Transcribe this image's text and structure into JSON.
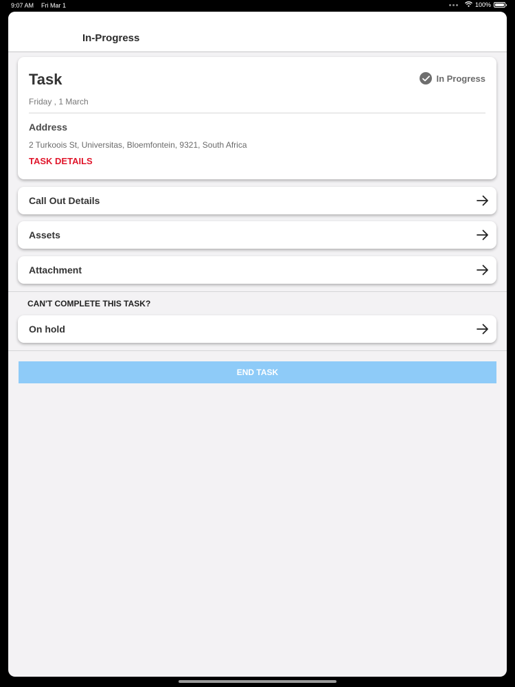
{
  "status_bar": {
    "time": "9:07 AM",
    "date": "Fri Mar 1",
    "battery": "100%",
    "icons": [
      "wifi-icon",
      "battery-icon"
    ]
  },
  "header": {
    "title": "In-Progress"
  },
  "task": {
    "title": "Task",
    "status": "In Progress",
    "date": "Friday , 1 March",
    "address_label": "Address",
    "address": "2 Turkoois St, Universitas, Bloemfontein, 9321, South Africa",
    "details_link": "TASK DETAILS"
  },
  "rows": {
    "call_out_details": "Call Out Details",
    "assets": "Assets",
    "attachment": "Attachment"
  },
  "cant_complete": {
    "label": "CAN'T COMPLETE THIS TASK?",
    "on_hold": "On hold"
  },
  "end_task": {
    "label": "END TASK"
  },
  "colors": {
    "accent_red": "#e0162b",
    "end_task_button": "#8ecbf8",
    "screen_background": "#f3f2f4"
  }
}
